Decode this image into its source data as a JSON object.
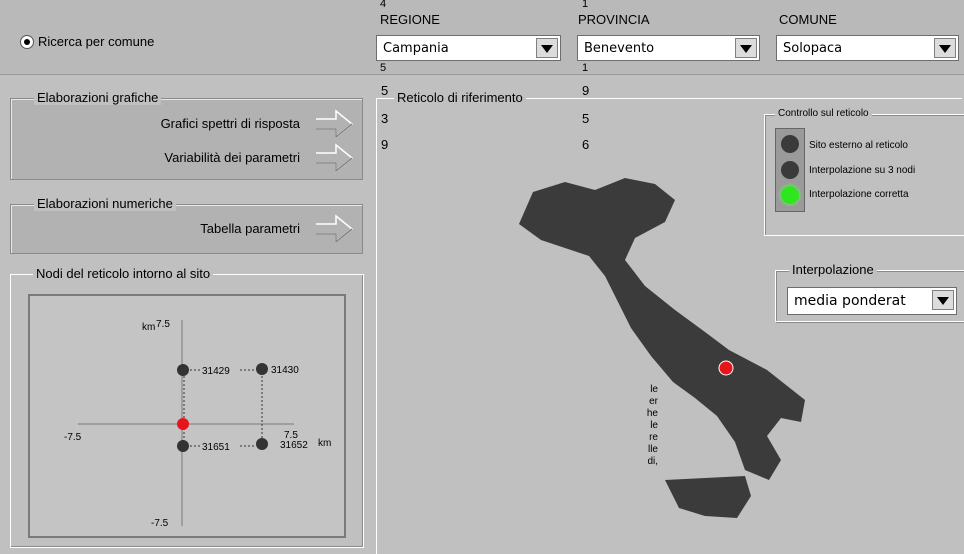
{
  "search": {
    "radio_label": "Ricerca per comune",
    "selected": true
  },
  "selectors": [
    {
      "label": "REGIONE",
      "value": "Campania",
      "stray_above": "4",
      "stray_below": "5"
    },
    {
      "label": "PROVINCIA",
      "value": "Benevento",
      "stray_above": "1",
      "stray_below": "1"
    },
    {
      "label": "COMUNE",
      "value": "Solopaca"
    }
  ],
  "graphic": {
    "title": "Elaborazioni grafiche",
    "btn1": "Grafici spettri di risposta",
    "btn2": "Variabilità dei parametri"
  },
  "numeric": {
    "title": "Elaborazioni numeriche",
    "btn1": "Tabella parametri"
  },
  "nodes": {
    "title": "Nodi del reticolo intorno al sito",
    "axis_top": "km",
    "ytop": "7.5",
    "xleft": "-7.5",
    "xright": "7.5",
    "x_unit": "km",
    "ybottom": "-7.5",
    "ids": [
      "31429",
      "31430",
      "31651",
      "31652"
    ]
  },
  "reticolo": {
    "title": "Reticolo di riferimento",
    "col_left": [
      "5",
      "3",
      "9"
    ],
    "col_right": [
      "9",
      "5",
      "6"
    ]
  },
  "controllo": {
    "title": "Controllo sul reticolo",
    "items": [
      {
        "label": "Sito esterno al reticolo",
        "state": "off"
      },
      {
        "label": "Interpolazione su 3 nodi",
        "state": "off"
      },
      {
        "label": "Interpolazione corretta",
        "state": "on"
      }
    ],
    "on_color": "#2ee61e",
    "off_color": "#3a3a3a"
  },
  "interpolazione": {
    "title": "Interpolazione",
    "value": "media ponderat"
  },
  "map": {
    "site_marker_color": "#e8141c",
    "country_color": "#3b3b3b"
  },
  "overflow_text": [
    "le",
    "er",
    "he",
    "le",
    "re",
    "lle",
    "di,"
  ]
}
